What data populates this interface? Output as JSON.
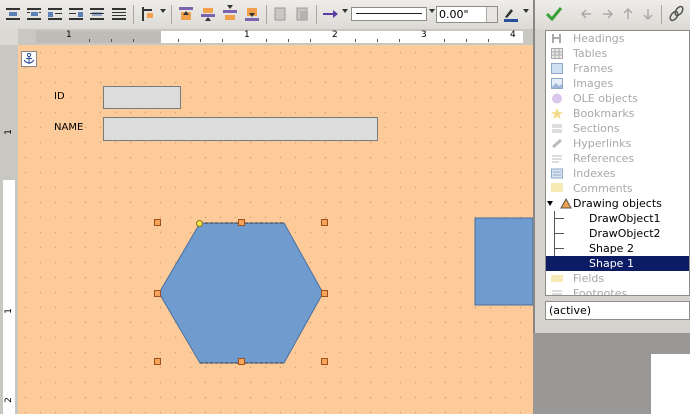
{
  "toolbar": {
    "line_width_value": "0.00\""
  },
  "ruler": {
    "h_numbers": [
      "1",
      "1",
      "2",
      "3",
      "4"
    ],
    "v_numbers": [
      "1",
      "1",
      "2"
    ]
  },
  "form": {
    "id_label": "ID",
    "name_label": "NAME"
  },
  "colors": {
    "page": "#fdcb9a",
    "shape_fill": "#6f9bcf",
    "selection": "#0b1b64"
  },
  "navigator": {
    "items": [
      {
        "label": "Headings",
        "icon": "headings-icon"
      },
      {
        "label": "Tables",
        "icon": "tables-icon"
      },
      {
        "label": "Frames",
        "icon": "frames-icon"
      },
      {
        "label": "Images",
        "icon": "images-icon"
      },
      {
        "label": "OLE objects",
        "icon": "ole-objects-icon"
      },
      {
        "label": "Bookmarks",
        "icon": "bookmarks-icon"
      },
      {
        "label": "Sections",
        "icon": "sections-icon"
      },
      {
        "label": "Hyperlinks",
        "icon": "hyperlinks-icon"
      },
      {
        "label": "References",
        "icon": "references-icon"
      },
      {
        "label": "Indexes",
        "icon": "indexes-icon"
      },
      {
        "label": "Comments",
        "icon": "comments-icon"
      },
      {
        "label": "Drawing objects",
        "icon": "drawing-objects-icon"
      }
    ],
    "drawing_children": [
      "DrawObject1",
      "DrawObject2",
      "Shape 2",
      "Shape 1"
    ],
    "after_items": [
      {
        "label": "Fields",
        "icon": "fields-icon"
      },
      {
        "label": "Footnotes",
        "icon": "footnotes-icon"
      }
    ],
    "document_status": "(active)"
  }
}
